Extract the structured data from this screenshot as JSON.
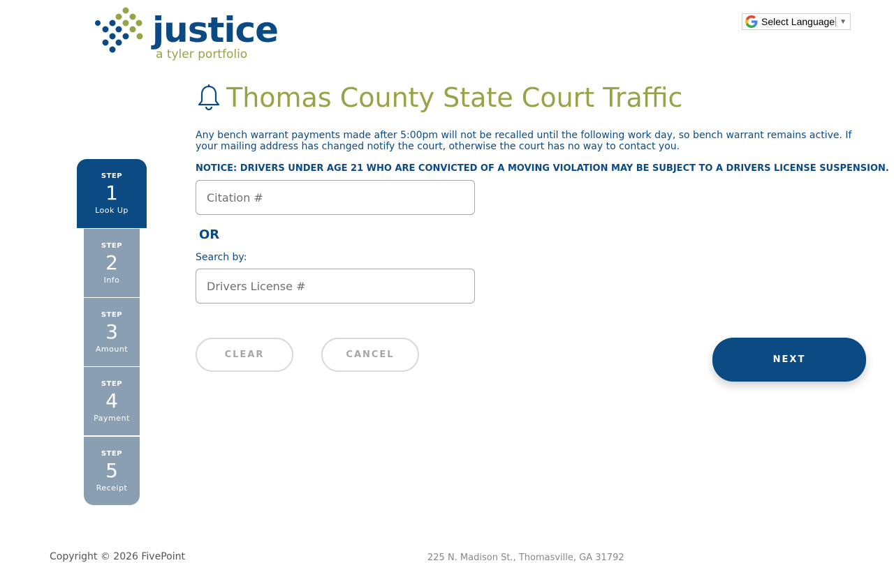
{
  "logo": {
    "word": "justice",
    "tagline": "a tyler portfolio",
    "colors": {
      "blue": "#0b4a83",
      "green": "#93a548"
    }
  },
  "language": {
    "label": "Select Language",
    "icon": "google-icon",
    "arrow": "▼"
  },
  "header": {
    "title": "Thomas County State Court Traffic",
    "icon": "bell-icon"
  },
  "info": {
    "message": "Any bench warrant payments made after 5:00pm will not be recalled until the following work day, so bench warrant remains active. If your mailing address has changed notify the court, otherwise the court has no way to contact you.",
    "notice": "NOTICE: DRIVERS UNDER AGE 21 WHO ARE CONVICTED OF A MOVING VIOLATION MAY BE SUBJECT TO A DRIVERS LICENSE SUSPENSION."
  },
  "form": {
    "citation_placeholder": "Citation #",
    "citation_value": "",
    "or_label": "OR",
    "search_by_label": "Search by:",
    "license_placeholder": "Drivers License #",
    "license_value": ""
  },
  "buttons": {
    "clear": "CLEAR",
    "cancel": "CANCEL",
    "next": "NEXT"
  },
  "steps": [
    {
      "label": "STEP",
      "number": "1",
      "name": "Look Up",
      "active": true
    },
    {
      "label": "STEP",
      "number": "2",
      "name": "Info",
      "active": false
    },
    {
      "label": "STEP",
      "number": "3",
      "name": "Amount",
      "active": false
    },
    {
      "label": "STEP",
      "number": "4",
      "name": "Payment",
      "active": false
    },
    {
      "label": "STEP",
      "number": "5",
      "name": "Receipt",
      "active": false
    }
  ],
  "footer": {
    "copyright": "Copyright © 2026 FivePoint",
    "address": "225 N. Madison St., Thomasville, GA 31792"
  },
  "colors": {
    "primary": "#0b4a83",
    "accent": "#93a548",
    "step_inactive": "#8b9fb2"
  }
}
